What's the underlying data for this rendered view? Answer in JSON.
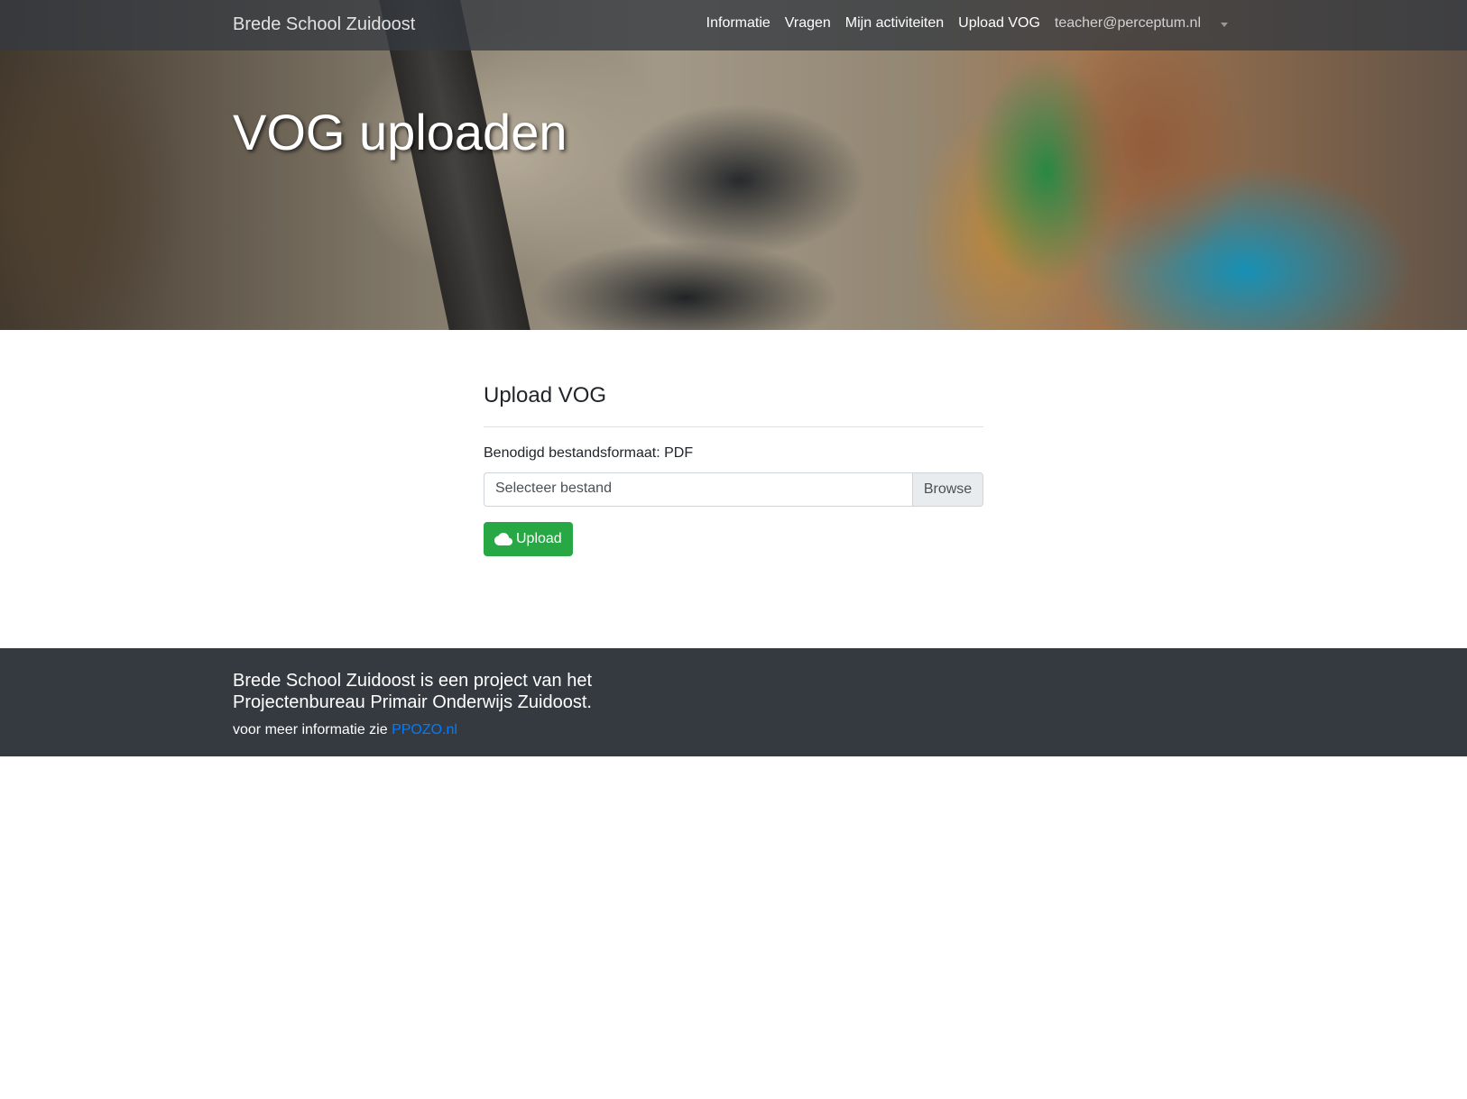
{
  "navbar": {
    "brand": "Brede School Zuidoost",
    "links": [
      "Informatie",
      "Vragen",
      "Mijn activiteiten",
      "Upload VOG"
    ],
    "user": "teacher@perceptum.nl"
  },
  "hero": {
    "title": "VOG uploaden"
  },
  "form": {
    "heading": "Upload VOG",
    "requirement": "Benodigd bestandsformaat: PDF",
    "file_placeholder": "Selecteer bestand",
    "browse_label": "Browse",
    "upload_label": "Upload",
    "upload_icon": "cloud-icon",
    "upload_color": "#28a745"
  },
  "footer": {
    "text": "Brede School Zuidoost is een project van het Projectenbureau Primair Onderwijs Zuidoost.",
    "more_prefix": "voor meer informatie zie",
    "link_label": "PPOZO.nl",
    "link_color": "#007bff",
    "background": "#343a40"
  }
}
